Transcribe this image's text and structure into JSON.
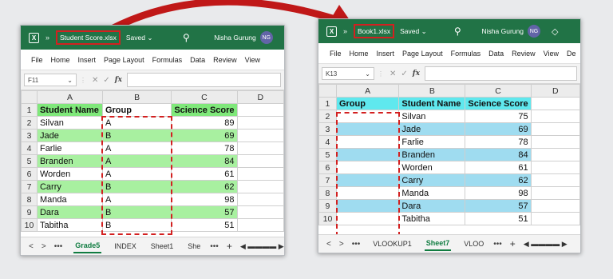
{
  "colors": {
    "titlebar": "#217346",
    "green_fill": "#a8f0a0",
    "blue_fill": "#9fdcf0",
    "cyan_header": "#5fe8ee",
    "green_header": "#7fe87a",
    "highlight": "#d32020",
    "arrow": "#d32020"
  },
  "window1": {
    "logo": "X",
    "chevron": "»",
    "file_name": "Student Score.xlsx",
    "saved": "Saved ⌄",
    "search_icon": "search-icon",
    "user_name": "Nisha Gurung",
    "avatar": "NG",
    "menu": [
      "File",
      "Home",
      "Insert",
      "Page Layout",
      "Formulas",
      "Data",
      "Review",
      "View"
    ],
    "name_box": "F11",
    "fx": "fx",
    "columns": [
      "A",
      "B",
      "C",
      "D"
    ],
    "rows": [
      {
        "n": "1",
        "a": "Student Name",
        "b": "Group",
        "c": "Science Score",
        "fill": "header"
      },
      {
        "n": "2",
        "a": "Silvan",
        "b": "A",
        "c": "89",
        "fill": "none"
      },
      {
        "n": "3",
        "a": "Jade",
        "b": "B",
        "c": "69",
        "fill": "green"
      },
      {
        "n": "4",
        "a": "Farlie",
        "b": "A",
        "c": "78",
        "fill": "none"
      },
      {
        "n": "5",
        "a": "Branden",
        "b": "A",
        "c": "84",
        "fill": "green"
      },
      {
        "n": "6",
        "a": "Worden",
        "b": "A",
        "c": "61",
        "fill": "none"
      },
      {
        "n": "7",
        "a": "Carry",
        "b": "B",
        "c": "62",
        "fill": "green"
      },
      {
        "n": "8",
        "a": "Manda",
        "b": "A",
        "c": "98",
        "fill": "none"
      },
      {
        "n": "9",
        "a": "Dara",
        "b": "B",
        "c": "57",
        "fill": "green"
      },
      {
        "n": "10",
        "a": "Tabitha",
        "b": "B",
        "c": "51",
        "fill": "none"
      }
    ],
    "sheets": [
      "Grade5",
      "INDEX",
      "Sheet1",
      "She"
    ],
    "active_sheet": "Grade5",
    "nav": [
      "<",
      ">",
      "•••"
    ],
    "more": "•••",
    "plus": "+"
  },
  "window2": {
    "logo": "X",
    "chevron": "»",
    "file_name": "Book1.xlsx",
    "saved": "Saved ⌄",
    "search_icon": "search-icon",
    "user_name": "Nisha Gurung",
    "avatar": "NG",
    "menu": [
      "File",
      "Home",
      "Insert",
      "Page Layout",
      "Formulas",
      "Data",
      "Review",
      "View",
      "De"
    ],
    "name_box": "K13",
    "fx": "fx",
    "columns": [
      "A",
      "B",
      "C",
      "D"
    ],
    "rows": [
      {
        "n": "1",
        "a": "Group",
        "b": "Student Name",
        "c": "Science Score",
        "fill": "header"
      },
      {
        "n": "2",
        "a": "",
        "b": "Silvan",
        "c": "75",
        "fill": "none"
      },
      {
        "n": "3",
        "a": "",
        "b": "Jade",
        "c": "69",
        "fill": "blue"
      },
      {
        "n": "4",
        "a": "",
        "b": "Farlie",
        "c": "78",
        "fill": "none"
      },
      {
        "n": "5",
        "a": "",
        "b": "Branden",
        "c": "84",
        "fill": "blue"
      },
      {
        "n": "6",
        "a": "",
        "b": "Worden",
        "c": "61",
        "fill": "none"
      },
      {
        "n": "7",
        "a": "",
        "b": "Carry",
        "c": "62",
        "fill": "blue"
      },
      {
        "n": "8",
        "a": "",
        "b": "Manda",
        "c": "98",
        "fill": "none"
      },
      {
        "n": "9",
        "a": "",
        "b": "Dara",
        "c": "57",
        "fill": "blue"
      },
      {
        "n": "10",
        "a": "",
        "b": "Tabitha",
        "c": "51",
        "fill": "none"
      }
    ],
    "sheets": [
      "VLOOKUP1",
      "Sheet7",
      "VLOO"
    ],
    "active_sheet": "Sheet7",
    "nav": [
      "<",
      ">",
      "•••"
    ],
    "more": "•••",
    "plus": "+"
  }
}
